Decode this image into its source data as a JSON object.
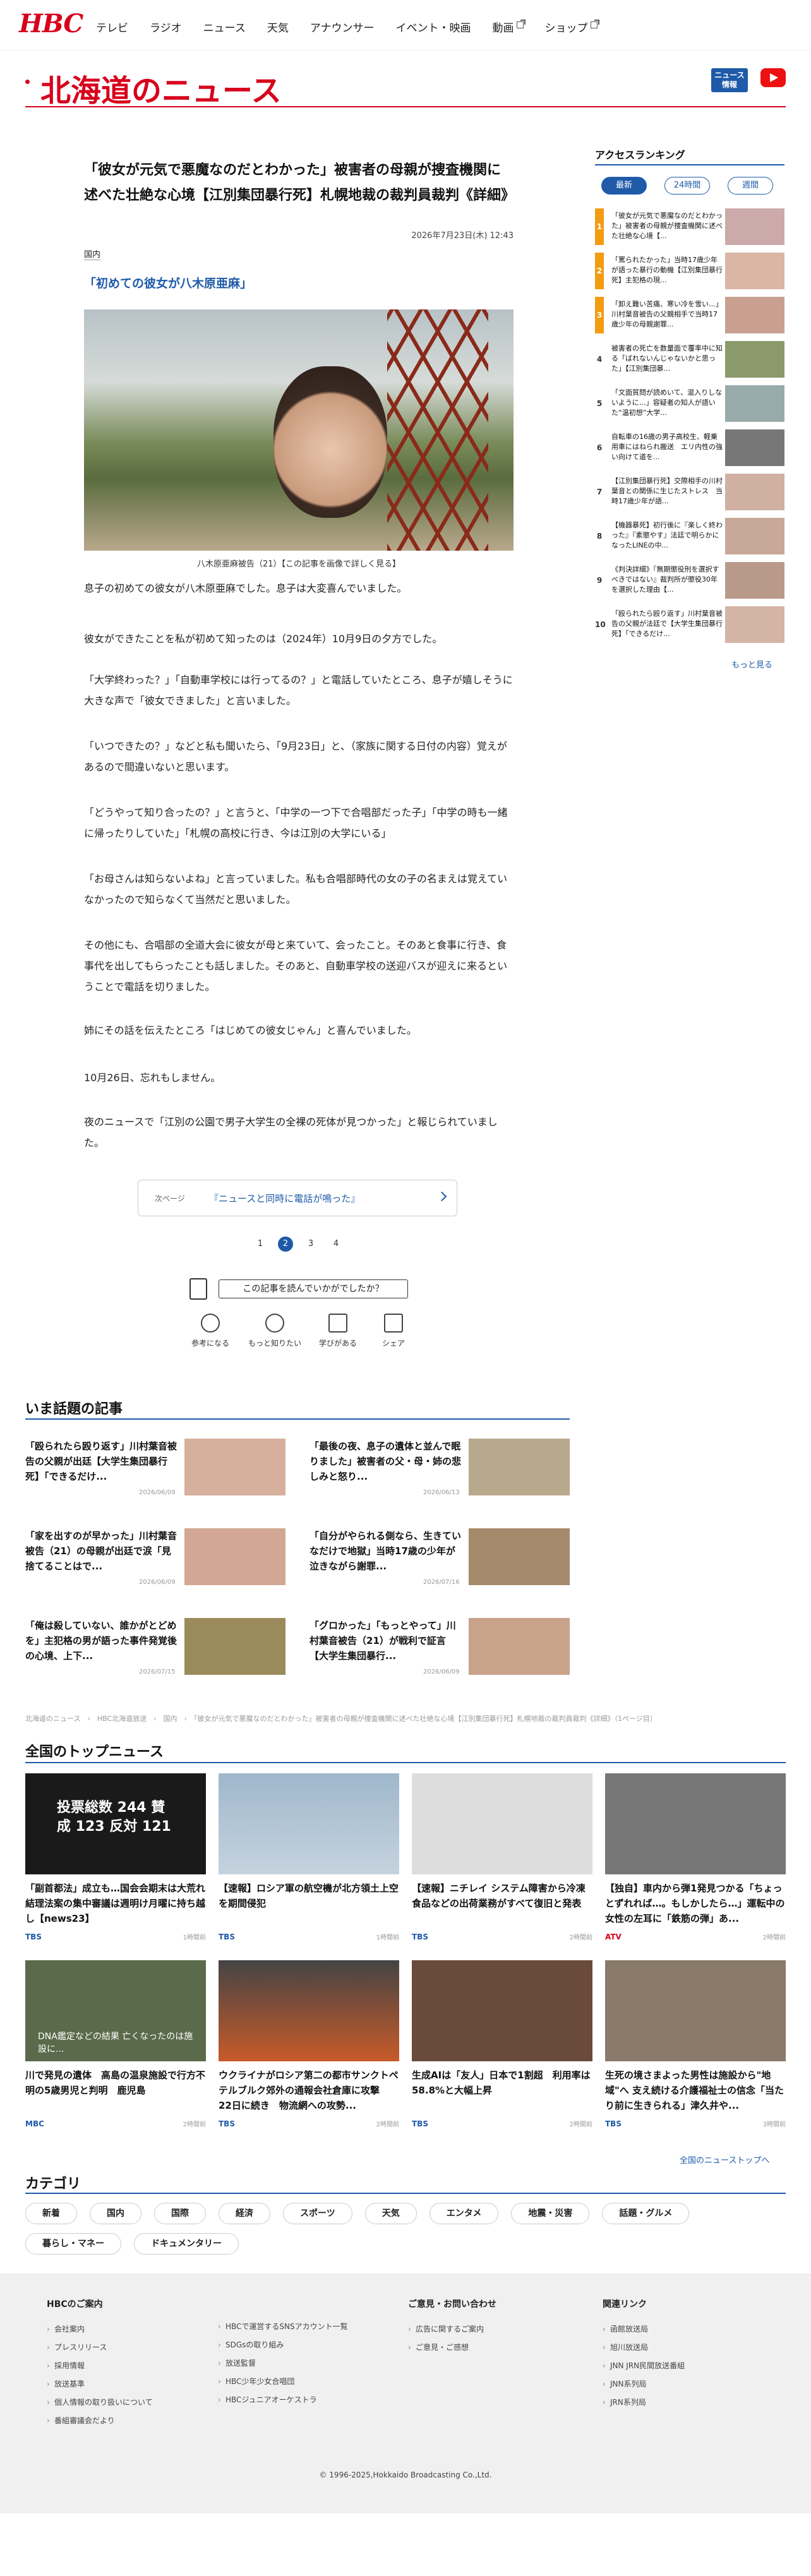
{
  "brand": {
    "logo": "HBC",
    "accent": "#d7001c",
    "blue": "#1e5aa8"
  },
  "nav": {
    "items": [
      "テレビ",
      "ラジオ",
      "ニュース",
      "天気",
      "アナウンサー",
      "イベント・映画",
      "動画",
      "ショップ"
    ]
  },
  "header": {
    "title": "北海道のニュース",
    "news_btn": "ニュース\n情報"
  },
  "article": {
    "title": "「彼女が元気で悪魔なのだとわかった」被害者の母親が捜査機関に述べた壮絶な心境【江別集団暴行死】札幌地裁の裁判員裁判《詳細》",
    "date": "2026年7月23日(木) 12:43",
    "category": "国内",
    "subhead": "「初めての彼女が八木原亜麻」",
    "caption": "八木原亜麻被告（21）",
    "caption_link": "【この記事を画像で詳しく見る】",
    "paragraphs": [
      "息子の初めての彼女が八木原亜麻でした。息子は大変喜んでいました。",
      "彼女ができたことを私が初めて知ったのは（2024年）10月9日の夕方でした。",
      "「大学終わった？」「自動車学校には行ってるの？」と電話していたところ、息子が嬉しそうに大きな声で「彼女できました」と言いました。",
      "「いつできたの？」などと私も聞いたら、「9月23日」と、（家族に関する日付の内容）覚えがあるので間違いないと思います。",
      "「どうやって知り合ったの？」と言うと、「中学の一つ下で合唱部だった子」「中学の時も一緒に帰ったりしていた」「札幌の高校に行き、今は江別の大学にいる」",
      "「お母さんは知らないよね」と言っていました。私も合唱部時代の女の子の名まえは覚えていなかったので知らなくて当然だと思いました。",
      "その他にも、合唱部の全道大会に彼女が母と来ていて、会ったこと。そのあと食事に行き、食事代を出してもらったことも話しました。そのあと、自動車学校の送迎バスが迎えに来るということで電話を切りました。",
      "姉にその話を伝えたところ「はじめての彼女じゃん」と喜んでいました。",
      "10月26日、忘れもしません。",
      "夜のニュースで「江別の公園で男子大学生の全裸の死体が見つかった」と報じられていました。"
    ],
    "next_label": "次ページ",
    "next_title": "『ニュースと同時に電話が鳴った』",
    "pages": [
      "1",
      "2",
      "3",
      "4"
    ],
    "survey": "この記事を読んでいかがでしたか？",
    "reactions": [
      "参考になる",
      "もっと知りたい",
      "学びがある",
      "シェア"
    ]
  },
  "ranking": {
    "title": "アクセスランキング",
    "tabs": [
      "最新",
      "24時間",
      "週間"
    ],
    "items": [
      {
        "n": "1",
        "t": "「彼女が元気で悪魔なのだとわかった」被害者の母親が捜査機関に述べた壮絶な心境【..."
      },
      {
        "n": "2",
        "t": "「罵られたかった」当時17歳少年が語った暴行の動機【江別集団暴行死】主犯格の現..."
      },
      {
        "n": "3",
        "t": "「卸え難い苦痛、寒い冷を雪い…」川村葉音被告の父親相手で当時17歳少年の母親謝罪..."
      },
      {
        "n": "4",
        "t": "被害者の死亡を数量面で覆率中に知る「ばれないんじゃないかと思った」【江別集団暴..."
      },
      {
        "n": "5",
        "t": "「文面質問が読めいて、混入りしないように…」容疑者の知人が語いた“温初想”大学..."
      },
      {
        "n": "6",
        "t": "自転車の16歳の男子高校生、軽乗用車にはねられ搬送　エリ内性の強い向けて道を..."
      },
      {
        "n": "7",
        "t": "【江別集団暴行死】交際相手の川村葉音との関係に生じたストレス　当時17歳少年が語..."
      },
      {
        "n": "8",
        "t": "【機器暴死】初行後に『楽しく終わった』『素懲やす』法廷で明らかになったLINEの中..."
      },
      {
        "n": "9",
        "t": "《判決詳細》『無期懲役刑を選択すべきではない』裁判所が懲役30年を選択した理由【..."
      },
      {
        "n": "10",
        "t": "「殴られたら殴り返す」川村葉音被告の父親が法廷で【大学生集団暴行死】「できるだけ..."
      }
    ],
    "more": "もっと見る"
  },
  "hot": {
    "title": "いま話題の記事",
    "items": [
      {
        "t": "「殴られたら殴り返す」川村葉音被告の父親が出廷【大学生集団暴行死】「できるだけ...",
        "d": "2026/06/09"
      },
      {
        "t": "「最後の夜、息子の遺体と並んで眠りました」被害者の父・母・姉の悲しみと怒り...",
        "d": "2026/06/13"
      },
      {
        "t": "「家を出すのが早かった」川村葉音被告（21）の母親が出廷で涙「見捨てることはで...",
        "d": "2026/06/09"
      },
      {
        "t": "「自分がやられる側なら、生きていなだけで地獄」当時17歳の少年が泣きながら謝罪...",
        "d": "2026/07/16"
      },
      {
        "t": "「俺は殺していない、誰かがとどめを」主犯格の男が語った事件発覚後の心境、上下...",
        "d": "2026/07/15"
      },
      {
        "t": "「グロかった」「もっとやって」川村葉音被告（21）が戦利で証言【大学生集団暴行...",
        "d": "2026/06/09"
      }
    ]
  },
  "breadcrumb": "北海道のニュース　›　HBC北海道放送　›　国内　›　「彼女が元気で悪魔なのだとわかった」被害者の母親が捜査機関に述べた壮絶な心境【江別集団暴行死】札幌地裁の裁判員裁判《詳細》（1ページ目）",
  "top": {
    "title": "全国のトップニュース",
    "items": [
      {
        "t": "「副首都法」成立も…国会会期末は大荒れ　結理法案の集中審議は週明け月曜に持ち越し【news23】",
        "src": "TBS",
        "ago": "1時間前",
        "overlay": "投票総数 244 賛成 123 反対 121"
      },
      {
        "t": "【速報】ロシア軍の航空機が北方領土上空を期間侵犯",
        "src": "TBS",
        "ago": "1時間前",
        "overlay": ""
      },
      {
        "t": "【速報】ニチレイ システム障害から冷凍食品などの出荷業務がすべて復旧と発表",
        "src": "TBS",
        "ago": "2時間前",
        "overlay": ""
      },
      {
        "t": "【独自】車内から弾1発見つかる「ちょっとずれれば…。もしかしたら…」運転中の女性の左耳に「鉄筋の弾」あ...",
        "src": "ATV",
        "ago": "2時間前",
        "overlay": ""
      },
      {
        "t": "川で発見の遺体　高島の温泉施設で行方不明の5歳男児と判明　鹿児島",
        "src": "MBC",
        "ago": "2時間前",
        "overlay": "DNA鑑定などの結果 亡くなったのは施設に..."
      },
      {
        "t": "ウクライナがロシア第二の都市サンクトペテルブルク郊外の通報会社倉庫に攻撃　22日に続き　物流網への攻勢...",
        "src": "TBS",
        "ago": "2時間前",
        "overlay": ""
      },
      {
        "t": "生成AIは「友人」日本で1割超　利用率は58.8%と大幅上昇",
        "src": "TBS",
        "ago": "2時間前",
        "overlay": ""
      },
      {
        "t": "生死の境さまよった男性は施設から\"地域\"へ 支え続ける介護福祉士の信念「当たり前に生きられる」津久井や...",
        "src": "TBS",
        "ago": "3時間前",
        "overlay": ""
      }
    ],
    "more": "全国のニューストップへ"
  },
  "categories": {
    "title": "カテゴリ",
    "items": [
      "新着",
      "国内",
      "国際",
      "経済",
      "スポーツ",
      "天気",
      "エンタメ",
      "地震・災害",
      "話題・グルメ",
      "暮らし・マネー",
      "ドキュメンタリー"
    ]
  },
  "footer": {
    "cols": [
      {
        "h": "HBCのご案内",
        "items": [
          "会社案内",
          "プレスリリース",
          "採用情報",
          "放送基準",
          "個人情報の取り扱いについて",
          "番組審議会だより"
        ]
      },
      {
        "h": "",
        "items": [
          "HBCで運営するSNSアカウント一覧",
          "SDGsの取り組み",
          "放送監督",
          "HBC少年少女合唱団",
          "HBCジュニアオーケストラ"
        ]
      },
      {
        "h": "ご意見・お問い合わせ",
        "items": [
          "広告に関するご案内",
          "ご意見・ご感想"
        ]
      },
      {
        "h": "関連リンク",
        "items": [
          "函館放送局",
          "旭川放送局",
          "JNN JRN民間放送番組",
          "JNN系列局",
          "JRN系列局"
        ]
      }
    ],
    "copyright": "© 1996-2025,Hokkaido Broadcasting Co.,Ltd."
  }
}
